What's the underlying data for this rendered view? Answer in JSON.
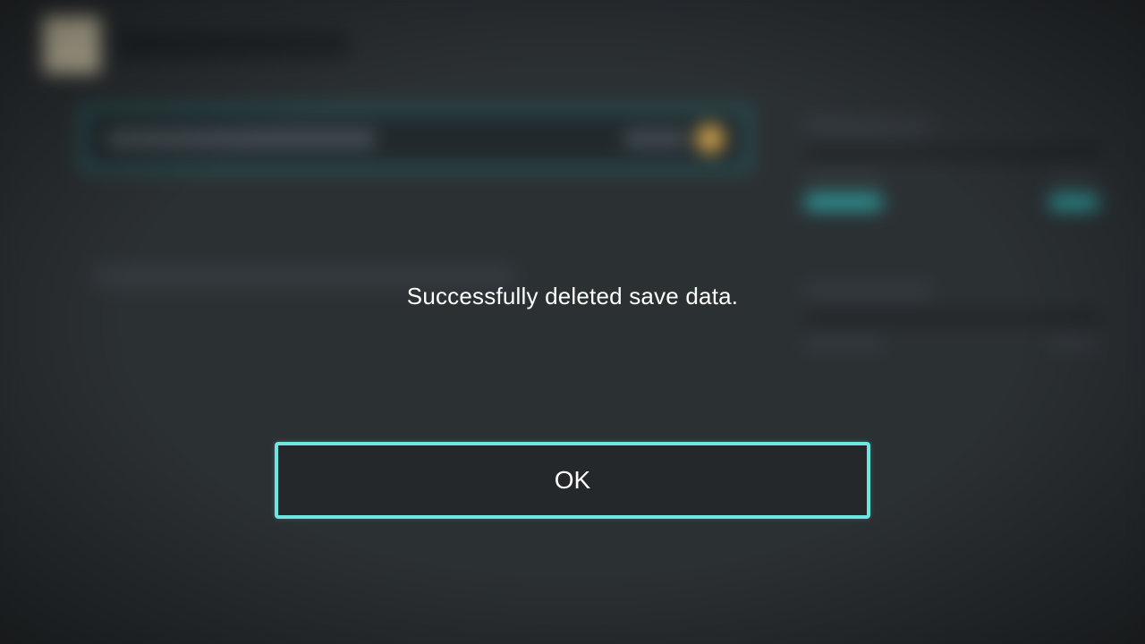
{
  "dialog": {
    "message": "Successfully deleted save data.",
    "ok_label": "OK"
  },
  "colors": {
    "accent": "#6be7df",
    "bg": "#2b3033"
  }
}
